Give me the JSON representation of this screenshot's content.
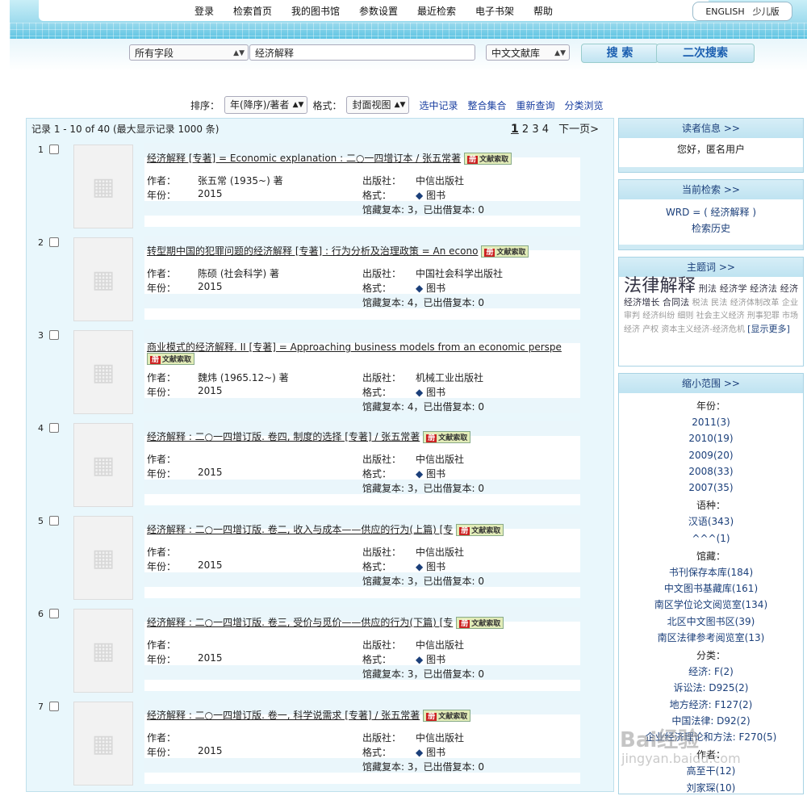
{
  "nav": {
    "items": [
      "登录",
      "检索首页",
      "我的图书馆",
      "参数设置",
      "最近检索",
      "电子书架",
      "帮助"
    ],
    "lang_en": "ENGLISH",
    "lang_kid": "少儿版"
  },
  "search": {
    "field": "所有字段",
    "query": "经济解释",
    "library": "中文文献库",
    "search_btn": "搜 索",
    "second_btn": "二次搜索"
  },
  "sort": {
    "sort_label": "排序：",
    "sort_value": "年(降序)/著者",
    "format_label": "格式：",
    "format_value": "封面视图",
    "links": [
      "选中记录",
      "整合集合",
      "重新查询",
      "分类浏览"
    ]
  },
  "results": {
    "header": "记录 1 - 10 of 40 (最大显示记录 1000 条)",
    "pages": [
      "1",
      "2",
      "3",
      "4"
    ],
    "next": "下一页>",
    "tag_label": "文献索取",
    "labels": {
      "author": "作者：",
      "year": "年份：",
      "publisher": "出版社：",
      "format": "格式：",
      "book": "图书"
    },
    "records": [
      {
        "n": "1",
        "title": "经济解释 [专著] = Economic explanation : 二○一四增订本 / 张五常著",
        "author": "张五常 (1935~) 著",
        "year": "2015",
        "publisher": "中信出版社",
        "holdings": "馆藏复本: 3，已出借复本: 0"
      },
      {
        "n": "2",
        "title": "转型期中国的犯罪问题的经济解释 [专著] : 行为分析及治理政策 = An econo",
        "author": "陈硕 (社会科学) 著",
        "year": "2015",
        "publisher": "中国社会科学出版社",
        "holdings": "馆藏复本: 4，已出借复本: 0"
      },
      {
        "n": "3",
        "title": "商业模式的经济解释. II [专著] = Approaching business models from an economic perspe",
        "author": "魏炜 (1965.12~) 著",
        "year": "2015",
        "publisher": "机械工业出版社",
        "holdings": "馆藏复本: 4，已出借复本: 0"
      },
      {
        "n": "4",
        "title": "经济解释 : 二○一四增订版. 卷四, 制度的选择 [专著] / 张五常著",
        "author": "",
        "year": "2015",
        "publisher": "中信出版社",
        "holdings": "馆藏复本: 3，已出借复本: 0"
      },
      {
        "n": "5",
        "title": "经济解释 : 二○一四增订版. 卷二, 收入与成本——供应的行为(上篇) [专",
        "author": "",
        "year": "2015",
        "publisher": "中信出版社",
        "holdings": "馆藏复本: 3，已出借复本: 0"
      },
      {
        "n": "6",
        "title": "经济解释 : 二○一四增订版. 卷三, 受价与觅价——供应的行为(下篇) [专",
        "author": "",
        "year": "2015",
        "publisher": "中信出版社",
        "holdings": "馆藏复本: 3，已出借复本: 0"
      },
      {
        "n": "7",
        "title": "经济解释 : 二○一四增订版. 卷一, 科学说需求 [专著] / 张五常著",
        "author": "",
        "year": "2015",
        "publisher": "中信出版社",
        "holdings": "馆藏复本: 3，已出借复本: 0"
      }
    ]
  },
  "sidebar": {
    "reader": {
      "title": "读者信息 >>",
      "text": "您好，匿名用户"
    },
    "current": {
      "title": "当前检索 >>",
      "query": "WRD = ( 经济解释 )",
      "history": "检索历史"
    },
    "subjects": {
      "title": "主题词 >>",
      "big": "法律解释",
      "md": [
        "刑法",
        "经济学",
        "经济法",
        "经济",
        "经济增长",
        "合同法"
      ],
      "sm": [
        "税法",
        "民法",
        "经济体制改革",
        "企业",
        "审判",
        "经济纠纷",
        "细则",
        "社会主义经济",
        "刑事犯罪",
        "市场经济",
        "产权",
        "资本主义经济-经济危机"
      ],
      "more": "[显示更多]"
    },
    "narrow": {
      "title": "缩小范围 >>",
      "items": [
        "年份：",
        "2011(3)",
        "2010(19)",
        "2009(20)",
        "2008(33)",
        "2007(35)",
        "语种：",
        "汉语(343)",
        "^^^(1)",
        "馆藏：",
        "书刊保存本库(184)",
        "中文图书基藏库(161)",
        "南区学位论文阅览室(134)",
        "北区中文图书区(39)",
        "南区法律参考阅览室(13)",
        "分类：",
        "经济: F(2)",
        "诉讼法: D925(2)",
        "地方经济: F127(2)",
        "中国法律: D92(2)",
        "企业经济理论和方法: F270(5)",
        "作者：",
        "高至干(12)",
        "刘家琛(10)"
      ]
    }
  }
}
